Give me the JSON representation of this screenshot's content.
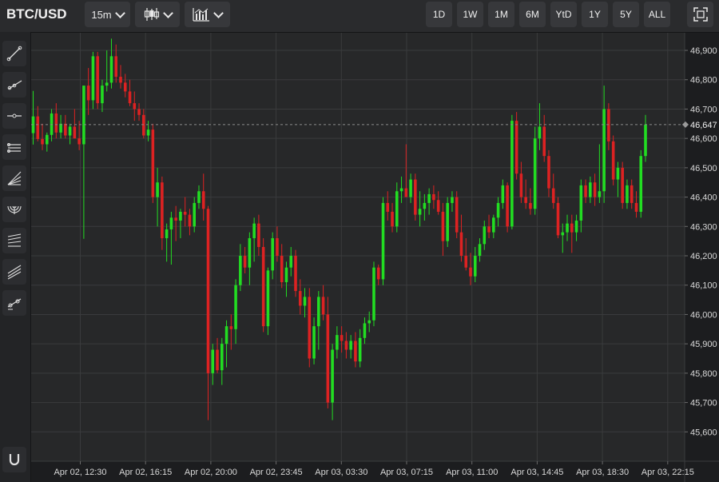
{
  "toolbar": {
    "symbol": "BTC/USD",
    "interval": "15m",
    "chart_type_icon": "candlestick-icon",
    "indicators_icon": "bar-chart-icon",
    "ranges": [
      "1D",
      "1W",
      "1M",
      "6M",
      "YtD",
      "1Y",
      "5Y",
      "ALL"
    ],
    "fullscreen_icon": "fullscreen-icon"
  },
  "drawing_tools": [
    "trend-line-icon",
    "ray-icon",
    "horizontal-line-icon",
    "parallel-channel-icon",
    "fib-fan-icon",
    "fib-arcs-icon",
    "fib-retracement-icon",
    "pitchfork-icon",
    "regression-icon",
    "magnet-icon"
  ],
  "colors": {
    "up": "#22dd22",
    "down": "#dd2222",
    "background": "#272829",
    "grid": "#3a3b3d"
  },
  "chart_data": {
    "type": "candlestick",
    "title": "BTC/USD",
    "ylim": [
      45500,
      46960
    ],
    "y_ticks": [
      45600,
      45700,
      45800,
      45900,
      46000,
      46100,
      46200,
      46300,
      46400,
      46500,
      46600,
      46700,
      46800,
      46900
    ],
    "x_tick_labels": [
      "Apr 02, 12:30",
      "Apr 02, 16:15",
      "Apr 02, 20:00",
      "Apr 02, 23:45",
      "Apr 03, 03:30",
      "Apr 03, 07:15",
      "Apr 03, 11:00",
      "Apr 03, 14:45",
      "Apr 03, 18:30",
      "Apr 03, 22:15"
    ],
    "last_price": 46647,
    "last_price_label": "46,647",
    "grid": true,
    "candles": [
      [
        46618,
        46762,
        46579,
        46675
      ],
      [
        46675,
        46710,
        46590,
        46598
      ],
      [
        46598,
        46650,
        46560,
        46580
      ],
      [
        46580,
        46620,
        46555,
        46612
      ],
      [
        46612,
        46700,
        46590,
        46685
      ],
      [
        46685,
        46720,
        46600,
        46620
      ],
      [
        46620,
        46680,
        46600,
        46650
      ],
      [
        46650,
        46680,
        46600,
        46610
      ],
      [
        46610,
        46650,
        46580,
        46640
      ],
      [
        46640,
        46700,
        46600,
        46600
      ],
      [
        46600,
        46660,
        46560,
        46580
      ],
      [
        46580,
        46760,
        46258,
        46780
      ],
      [
        46780,
        46840,
        46680,
        46730
      ],
      [
        46730,
        46895,
        46700,
        46880
      ],
      [
        46880,
        46895,
        46700,
        46720
      ],
      [
        46720,
        46800,
        46690,
        46780
      ],
      [
        46780,
        46900,
        46760,
        46790
      ],
      [
        46790,
        46940,
        46770,
        46880
      ],
      [
        46880,
        46920,
        46790,
        46810
      ],
      [
        46810,
        46850,
        46770,
        46790
      ],
      [
        46790,
        46820,
        46740,
        46760
      ],
      [
        46760,
        46800,
        46710,
        46720
      ],
      [
        46720,
        46760,
        46660,
        46700
      ],
      [
        46700,
        46720,
        46660,
        46680
      ],
      [
        46680,
        46700,
        46600,
        46610
      ],
      [
        46610,
        46660,
        46590,
        46630
      ],
      [
        46630,
        46650,
        46380,
        46400
      ],
      [
        46400,
        46500,
        46300,
        46450
      ],
      [
        46450,
        46470,
        46220,
        46260
      ],
      [
        46260,
        46310,
        46180,
        46290
      ],
      [
        46290,
        46350,
        46170,
        46330
      ],
      [
        46330,
        46370,
        46250,
        46320
      ],
      [
        46320,
        46360,
        46260,
        46350
      ],
      [
        46350,
        46400,
        46300,
        46340
      ],
      [
        46340,
        46360,
        46270,
        46300
      ],
      [
        46300,
        46400,
        46280,
        46380
      ],
      [
        46380,
        46440,
        46360,
        46420
      ],
      [
        46420,
        46480,
        46320,
        46360
      ],
      [
        46360,
        46370,
        45640,
        45800
      ],
      [
        45800,
        45900,
        45760,
        45880
      ],
      [
        45880,
        45920,
        45800,
        45810
      ],
      [
        45810,
        45920,
        45760,
        45900
      ],
      [
        45900,
        45980,
        45820,
        45960
      ],
      [
        45960,
        46000,
        45880,
        45950
      ],
      [
        45950,
        46120,
        45900,
        46100
      ],
      [
        46100,
        46240,
        46080,
        46200
      ],
      [
        46200,
        46230,
        46140,
        46160
      ],
      [
        46160,
        46280,
        46100,
        46260
      ],
      [
        46260,
        46330,
        46180,
        46310
      ],
      [
        46310,
        46340,
        46200,
        46230
      ],
      [
        46230,
        46260,
        45940,
        45960
      ],
      [
        45960,
        46160,
        45930,
        46150
      ],
      [
        46150,
        46280,
        46120,
        46260
      ],
      [
        46260,
        46300,
        46180,
        46200
      ],
      [
        46200,
        46240,
        46090,
        46110
      ],
      [
        46110,
        46180,
        46060,
        46160
      ],
      [
        46160,
        46230,
        46130,
        46200
      ],
      [
        46200,
        46220,
        46060,
        46080
      ],
      [
        46080,
        46120,
        46000,
        46030
      ],
      [
        46030,
        46090,
        45990,
        46060
      ],
      [
        46060,
        46090,
        45820,
        45850
      ],
      [
        45850,
        45990,
        45830,
        45960
      ],
      [
        45960,
        46080,
        45880,
        46060
      ],
      [
        46060,
        46100,
        45980,
        46000
      ],
      [
        46000,
        46060,
        45680,
        45700
      ],
      [
        45700,
        45900,
        45640,
        45880
      ],
      [
        45880,
        45960,
        45850,
        45930
      ],
      [
        45930,
        45960,
        45870,
        45910
      ],
      [
        45910,
        45940,
        45850,
        45880
      ],
      [
        45880,
        45930,
        45850,
        45910
      ],
      [
        45910,
        45940,
        45820,
        45840
      ],
      [
        45840,
        45950,
        45820,
        45920
      ],
      [
        45920,
        45990,
        45900,
        45970
      ],
      [
        45970,
        46010,
        45940,
        45980
      ],
      [
        45980,
        46180,
        45960,
        46160
      ],
      [
        46160,
        46170,
        46100,
        46120
      ],
      [
        46120,
        46400,
        46100,
        46380
      ],
      [
        46380,
        46420,
        46320,
        46350
      ],
      [
        46350,
        46380,
        46280,
        46300
      ],
      [
        46300,
        46450,
        46280,
        46420
      ],
      [
        46420,
        46470,
        46380,
        46430
      ],
      [
        46430,
        46580,
        46400,
        46400
      ],
      [
        46400,
        46480,
        46380,
        46460
      ],
      [
        46460,
        46480,
        46320,
        46340
      ],
      [
        46340,
        46420,
        46300,
        46360
      ],
      [
        46360,
        46410,
        46320,
        46380
      ],
      [
        46380,
        46430,
        46340,
        46410
      ],
      [
        46410,
        46440,
        46360,
        46390
      ],
      [
        46390,
        46420,
        46340,
        46350
      ],
      [
        46350,
        46380,
        46200,
        46250
      ],
      [
        46250,
        46400,
        46230,
        46380
      ],
      [
        46380,
        46420,
        46350,
        46400
      ],
      [
        46400,
        46420,
        46260,
        46280
      ],
      [
        46280,
        46340,
        46180,
        46200
      ],
      [
        46200,
        46260,
        46150,
        46160
      ],
      [
        46160,
        46210,
        46100,
        46130
      ],
      [
        46130,
        46230,
        46110,
        46200
      ],
      [
        46200,
        46260,
        46180,
        46240
      ],
      [
        46240,
        46320,
        46220,
        46300
      ],
      [
        46300,
        46340,
        46260,
        46280
      ],
      [
        46280,
        46340,
        46260,
        46330
      ],
      [
        46330,
        46400,
        46300,
        46380
      ],
      [
        46380,
        46460,
        46360,
        46440
      ],
      [
        46440,
        46450,
        46280,
        46300
      ],
      [
        46300,
        46680,
        46290,
        46660
      ],
      [
        46660,
        46690,
        46460,
        46480
      ],
      [
        46480,
        46520,
        46380,
        46400
      ],
      [
        46400,
        46460,
        46360,
        46380
      ],
      [
        46380,
        46430,
        46340,
        46360
      ],
      [
        46360,
        46640,
        46340,
        46600
      ],
      [
        46600,
        46720,
        46560,
        46640
      ],
      [
        46640,
        46680,
        46520,
        46540
      ],
      [
        46540,
        46560,
        46400,
        46430
      ],
      [
        46430,
        46480,
        46360,
        46380
      ],
      [
        46380,
        46400,
        46260,
        46270
      ],
      [
        46270,
        46310,
        46210,
        46280
      ],
      [
        46280,
        46340,
        46250,
        46310
      ],
      [
        46310,
        46340,
        46210,
        46280
      ],
      [
        46280,
        46340,
        46250,
        46320
      ],
      [
        46320,
        46460,
        46280,
        46440
      ],
      [
        46440,
        46460,
        46380,
        46400
      ],
      [
        46400,
        46470,
        46380,
        46450
      ],
      [
        46450,
        46480,
        46370,
        46400
      ],
      [
        46400,
        46580,
        46380,
        46420
      ],
      [
        46420,
        46780,
        46380,
        46700
      ],
      [
        46700,
        46720,
        46560,
        46590
      ],
      [
        46590,
        46610,
        46440,
        46460
      ],
      [
        46460,
        46520,
        46400,
        46500
      ],
      [
        46500,
        46520,
        46360,
        46380
      ],
      [
        46380,
        46460,
        46360,
        46440
      ],
      [
        46440,
        46460,
        46360,
        46380
      ],
      [
        46380,
        46420,
        46330,
        46350
      ],
      [
        46350,
        46560,
        46330,
        46540
      ],
      [
        46540,
        46680,
        46520,
        46647
      ]
    ]
  }
}
